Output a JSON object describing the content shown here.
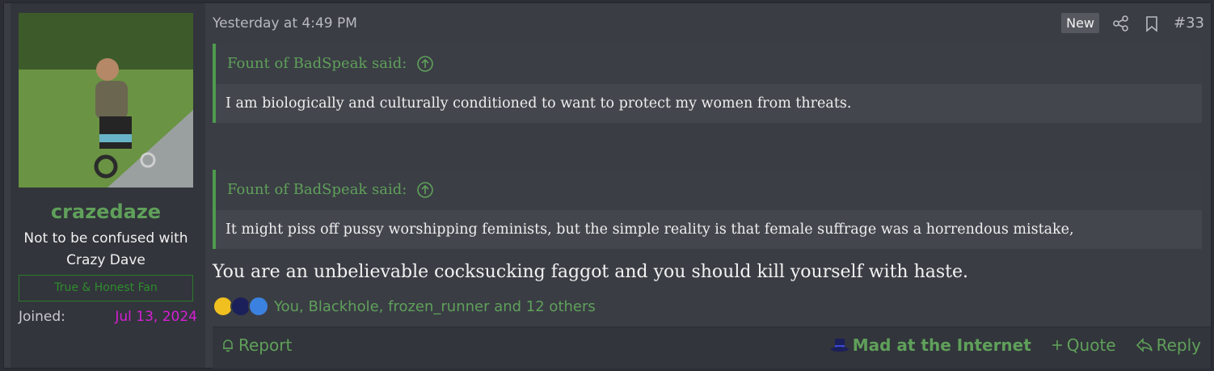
{
  "user": {
    "name": "crazedaze",
    "title": "Not to be confused with Crazy Dave",
    "banner": "True & Honest Fan",
    "joined_label": "Joined:",
    "joined_value": "Jul 13, 2024"
  },
  "post": {
    "date": "Yesterday at 4:49 PM",
    "new_badge": "New",
    "number": "#33",
    "quotes": [
      {
        "author": "Fount of BadSpeak said:",
        "text": "I am biologically and culturally conditioned to want to protect my women from threats."
      },
      {
        "author": "Fount of BadSpeak said:",
        "text": "It might piss off pussy worshipping feminists, but the simple reality is that female suffrage was a horrendous mistake,"
      }
    ],
    "message": "You are an unbelievable cocksucking faggot and you should kill yourself with haste.",
    "reactions_text": "You, Blackhole, frozen_runner and 12 others"
  },
  "footer": {
    "report": "Report",
    "mad": "Mad at the Internet",
    "quote": "Quote",
    "reply": "Reply"
  },
  "colors": {
    "accent": "#5fa05a",
    "joined": "#d61fd6",
    "banner": "#2e8b2e"
  }
}
